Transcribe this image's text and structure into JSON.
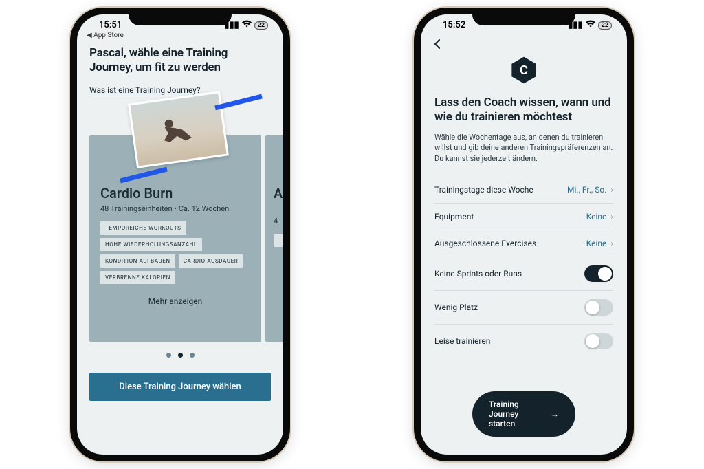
{
  "status": {
    "time_left": "15:51",
    "time_right": "15:52",
    "battery": "22",
    "back_appstore": "App Store"
  },
  "screen1": {
    "heading": "Pascal, wähle eine Training Journey, um fit zu werden",
    "link": "Was ist eine Training Journey?",
    "card": {
      "title": "Cardio Burn",
      "subtitle": "48 Trainingseinheiten • Ca. 12 Wochen",
      "tags": [
        "TEMPOREICHE WORKOUTS",
        "HOHE WIEDERHOLUNGSANZAHL",
        "KONDITION AUFBAUEN",
        "CARDIO-AUSDAUER",
        "VERBRENNE KALORIEN"
      ],
      "more": "Mehr anzeigen"
    },
    "peek": {
      "title_frag": "A",
      "sub_frag": "4"
    },
    "cta": "Diese Training Journey wählen"
  },
  "screen2": {
    "heading": "Lass den Coach wissen, wann und wie du trainieren möchtest",
    "para": "Wähle die Wochentage aus, an denen du trainieren willst und gib deine anderen Trainingspräferenzen an. Du kannst sie jederzeit ändern.",
    "rows": {
      "days_label": "Trainingstage diese Woche",
      "days_value": "Mi., Fr., So.",
      "equip_label": "Equipment",
      "equip_value": "Keine",
      "excl_label": "Ausgeschlossene Exercises",
      "excl_value": "Keine",
      "sprints_label": "Keine Sprints oder Runs",
      "space_label": "Wenig Platz",
      "quiet_label": "Leise trainieren"
    },
    "cta": "Training Journey starten"
  }
}
